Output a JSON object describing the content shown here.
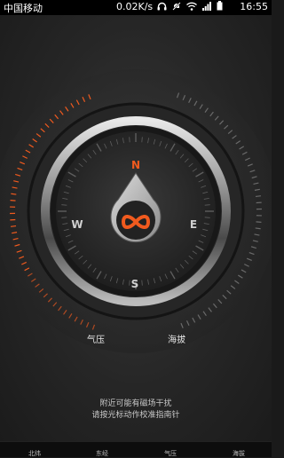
{
  "status_bar": {
    "carrier": "中国移动",
    "net_speed": "0.02K/s",
    "time": "16:55",
    "icons": [
      "headphones-icon",
      "mute-icon",
      "wifi-icon",
      "signal-icon",
      "battery-icon"
    ]
  },
  "compass": {
    "directions": {
      "north": "N",
      "east": "E",
      "south": "S",
      "west": "W"
    },
    "center_icon": "infinity-icon",
    "accent_color": "#f05a1e"
  },
  "gauges": {
    "pressure_label": "气压",
    "altitude_label": "海拔"
  },
  "hint": {
    "line1": "附近可能有磁场干扰",
    "line2": "请按光标动作校准指南针"
  },
  "bottom_tabs": [
    "北纬",
    "东经",
    "气压",
    "海拔"
  ]
}
